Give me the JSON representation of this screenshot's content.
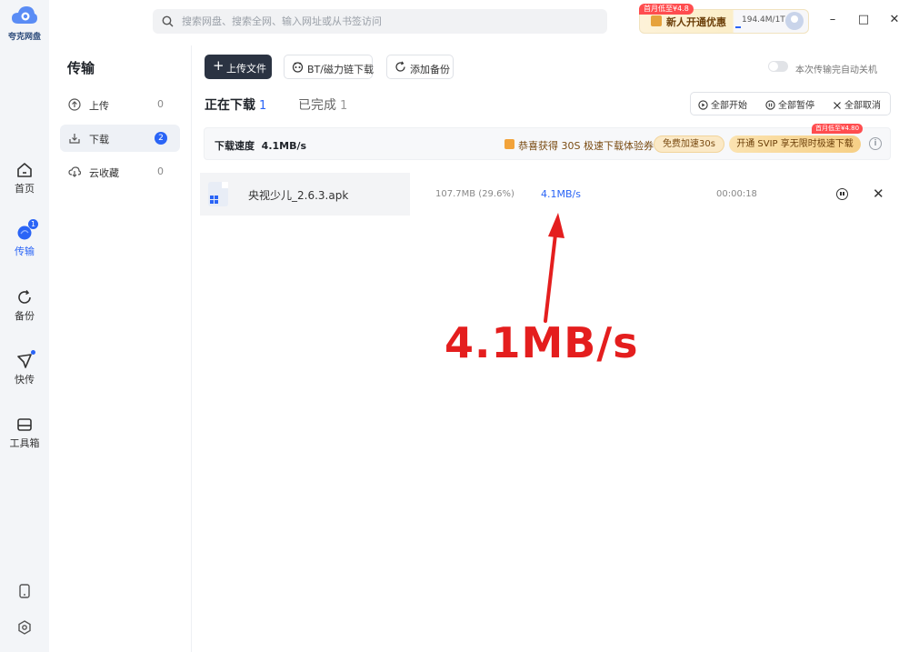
{
  "app": {
    "name": "夸克网盘"
  },
  "rail": {
    "items": [
      {
        "key": "home",
        "label": "首页",
        "icon": "home-icon"
      },
      {
        "key": "transfer",
        "label": "传输",
        "icon": "transfer-icon",
        "badge": "1"
      },
      {
        "key": "backup",
        "label": "备份",
        "icon": "backup-icon"
      },
      {
        "key": "quick",
        "label": "快传",
        "icon": "send-icon"
      },
      {
        "key": "tools",
        "label": "工具箱",
        "icon": "toolbox-icon"
      }
    ],
    "bottom": [
      "phone-icon",
      "settings-icon"
    ]
  },
  "search": {
    "placeholder": "搜索网盘、搜索全网、输入网址或从书签访问"
  },
  "promo": {
    "tag": "首月低至¥4.8",
    "text": "新人开通优惠",
    "storage": "194.4M/1T",
    "storage_used_fraction": 0.0002
  },
  "window": {
    "minimize": "–",
    "maximize": "□",
    "close": "✕"
  },
  "transfer": {
    "title": "传输",
    "items": [
      {
        "label": "上传",
        "count": "0",
        "icon": "upload-icon"
      },
      {
        "label": "下载",
        "count": "2",
        "icon": "download-icon"
      },
      {
        "label": "云收藏",
        "count": "0",
        "icon": "cloud-save-icon"
      }
    ]
  },
  "toolbar": {
    "upload_label": "上传文件",
    "bt_label": "BT/磁力链下载",
    "backup_label": "添加备份",
    "auto_shutdown_label": "本次传输完自动关机"
  },
  "tabs": [
    {
      "label": "正在下载",
      "count": "1"
    },
    {
      "label": "已完成",
      "count": "1"
    }
  ],
  "bulk": {
    "start_all": "全部开始",
    "pause_all": "全部暂停",
    "cancel_all": "全部取消"
  },
  "speed": {
    "label": "下载速度",
    "value": "4.1MB/s",
    "promo_text": "恭喜获得 30S 极速下载体验券",
    "free_btn": "免费加速30s",
    "svip_btn": "开通 SVIP 享无限时极速下载",
    "svip_tag": "首月低至¥4.80",
    "info": "i"
  },
  "downloads": [
    {
      "name": "央视少儿_2.6.3.apk",
      "size": "107.7MB (29.6%)",
      "speed": "4.1MB/s",
      "time": "00:00:18"
    }
  ],
  "annotation": {
    "text": "4.1MB/s",
    "color": "#e41e1e"
  },
  "colors": {
    "accent": "#2a64f6",
    "primary_button": "#2b3342"
  }
}
